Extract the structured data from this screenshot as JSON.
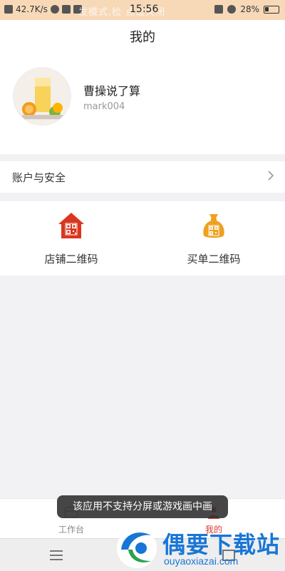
{
  "status_bar": {
    "speed": "42.7K/s",
    "time": "15:56",
    "ghost_text": "发模式,检        点击关闭",
    "battery": "28%"
  },
  "header": {
    "title": "我的"
  },
  "profile": {
    "name": "曹操说了算",
    "id": "mark004"
  },
  "account_row": {
    "label": "账户与安全"
  },
  "qr_items": [
    {
      "label": "店铺二维码",
      "color": "#d9361f",
      "icon": "shop-qr-icon"
    },
    {
      "label": "买单二维码",
      "color": "#f0a01f",
      "icon": "bag-qr-icon"
    }
  ],
  "tabbar": [
    {
      "label": "工作台",
      "icon": "workbench-icon",
      "active": false
    },
    {
      "label": "我的",
      "icon": "profile-icon",
      "active": true
    }
  ],
  "toast": {
    "text": "该应用不支持分屏或游戏画中画"
  },
  "watermark": {
    "title": "偶要下载站",
    "url": "ouyaoxiazai.com"
  },
  "colors": {
    "accent": "#e0392b",
    "page_bg": "#f2f2f5",
    "status_bg": "#f7d9b8",
    "watermark": "#1876d6"
  }
}
